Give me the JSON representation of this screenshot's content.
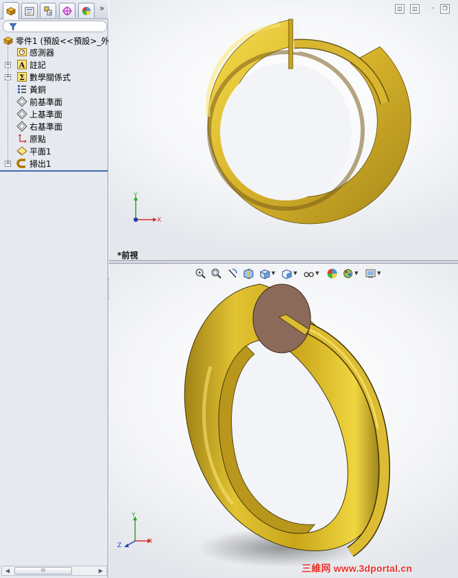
{
  "panel": {
    "tabs": [
      "feature-manager-tab",
      "property-manager-tab",
      "configuration-manager-tab",
      "dimxpert-tab",
      "appearance-tab"
    ],
    "more_label": "»"
  },
  "tree": {
    "root": "零件1  (預設<<預設>_外",
    "items": [
      {
        "label": "感測器",
        "icon": "sensor-icon",
        "expandable": false
      },
      {
        "label": "註記",
        "icon": "annotation-icon",
        "expandable": true
      },
      {
        "label": "數學關係式",
        "icon": "equations-icon",
        "expandable": true
      },
      {
        "label": "黃銅",
        "icon": "material-icon",
        "expandable": false
      },
      {
        "label": "前基準面",
        "icon": "plane-icon",
        "expandable": false
      },
      {
        "label": "上基準面",
        "icon": "plane-icon",
        "expandable": false
      },
      {
        "label": "右基準面",
        "icon": "plane-icon",
        "expandable": false
      },
      {
        "label": "原點",
        "icon": "origin-icon",
        "expandable": false
      },
      {
        "label": "平面1",
        "icon": "plane1-icon",
        "expandable": false
      },
      {
        "label": "掃出1",
        "icon": "sweep-icon",
        "expandable": true
      }
    ]
  },
  "viewports": {
    "top_view_name": "*前視",
    "top_axes": {
      "y": "Y",
      "x": "X"
    },
    "bottom_axes": {
      "y": "Y",
      "x": "X",
      "z": "Z"
    }
  },
  "scrollbar": {
    "thumb": "III"
  },
  "watermark": {
    "brand": "三維网",
    "url": "www.3dportal.cn"
  },
  "colors": {
    "brass_light": "#f3d33a",
    "brass_mid": "#c9a51a",
    "brass_dark": "#6e5a0a",
    "section_face": "#8b6a5a",
    "selection_blue": "#3f69b1"
  }
}
